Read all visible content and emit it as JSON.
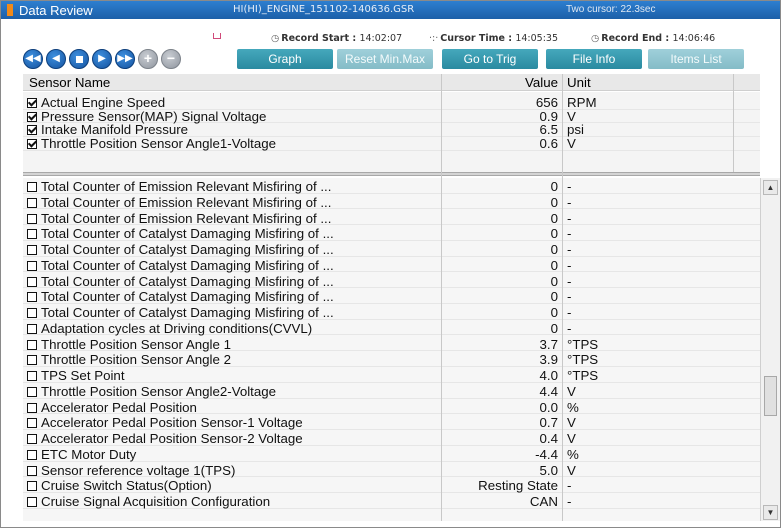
{
  "window": {
    "title": "Data Review",
    "file": "HI(HI)_ENGINE_151102-140636.GSR",
    "cursor_info": "Two cursor: 22.3sec"
  },
  "record": {
    "start_label": "Record Start :",
    "start_value": "14:02:07",
    "cursor_label": "Cursor Time :",
    "cursor_value": "14:05:35",
    "end_label": "Record End :",
    "end_value": "14:06:46"
  },
  "buttons": {
    "graph": "Graph",
    "reset": "Reset Min.Max",
    "goto_trig": "Go to Trig",
    "file_info": "File Info",
    "items_list": "Items List"
  },
  "columns": {
    "name": "Sensor Name",
    "value": "Value",
    "unit": "Unit"
  },
  "selected_sensors": [
    {
      "name": "Actual Engine Speed",
      "value": "656",
      "unit": "RPM"
    },
    {
      "name": "Pressure Sensor(MAP) Signal Voltage",
      "value": "0.9",
      "unit": "V"
    },
    {
      "name": "Intake Manifold Pressure",
      "value": "6.5",
      "unit": "psi"
    },
    {
      "name": "Throttle Position Sensor Angle1-Voltage",
      "value": "0.6",
      "unit": "V"
    }
  ],
  "sensors": [
    {
      "name": "Total Counter of Emission Relevant Misfiring of ...",
      "value": "0",
      "unit": "-"
    },
    {
      "name": "Total Counter of Emission Relevant Misfiring of ...",
      "value": "0",
      "unit": "-"
    },
    {
      "name": "Total Counter of Emission Relevant Misfiring of ...",
      "value": "0",
      "unit": "-"
    },
    {
      "name": "Total Counter of Catalyst Damaging Misfiring of ...",
      "value": "0",
      "unit": "-"
    },
    {
      "name": "Total Counter of Catalyst Damaging Misfiring of ...",
      "value": "0",
      "unit": "-"
    },
    {
      "name": "Total Counter of Catalyst Damaging Misfiring of ...",
      "value": "0",
      "unit": "-"
    },
    {
      "name": "Total Counter of Catalyst Damaging Misfiring of ...",
      "value": "0",
      "unit": "-"
    },
    {
      "name": "Total Counter of Catalyst Damaging Misfiring of ...",
      "value": "0",
      "unit": "-"
    },
    {
      "name": "Total Counter of Catalyst Damaging Misfiring of ...",
      "value": "0",
      "unit": "-"
    },
    {
      "name": "Adaptation cycles at Driving conditions(CVVL)",
      "value": "0",
      "unit": "-"
    },
    {
      "name": "Throttle Position Sensor Angle 1",
      "value": "3.7",
      "unit": "°TPS"
    },
    {
      "name": "Throttle Position Sensor Angle 2",
      "value": "3.9",
      "unit": "°TPS"
    },
    {
      "name": "TPS Set Point",
      "value": "4.0",
      "unit": "°TPS"
    },
    {
      "name": "Throttle Position Sensor Angle2-Voltage",
      "value": "4.4",
      "unit": "V"
    },
    {
      "name": "Accelerator Pedal Position",
      "value": "0.0",
      "unit": "%"
    },
    {
      "name": "Accelerator Pedal Position Sensor-1 Voltage",
      "value": "0.7",
      "unit": "V"
    },
    {
      "name": "Accelerator Pedal Position Sensor-2 Voltage",
      "value": "0.4",
      "unit": "V"
    },
    {
      "name": "ETC Motor Duty",
      "value": "-4.4",
      "unit": "%"
    },
    {
      "name": "Sensor reference voltage 1(TPS)",
      "value": "5.0",
      "unit": "V"
    },
    {
      "name": "Cruise Switch Status(Option)",
      "value": "Resting State",
      "unit": "-"
    },
    {
      "name": "Cruise Signal Acquisition Configuration",
      "value": "CAN",
      "unit": "-"
    }
  ]
}
